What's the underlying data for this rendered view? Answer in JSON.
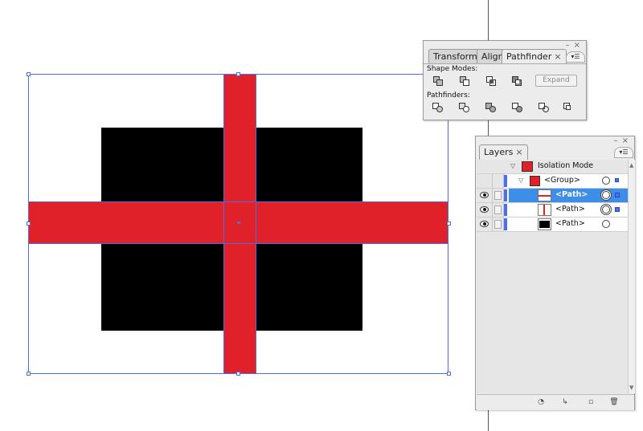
{
  "pathfinder_panel": {
    "tabs": [
      {
        "label": "Transform",
        "active": false
      },
      {
        "label": "Align",
        "active": false
      },
      {
        "label": "Pathfinder",
        "active": true,
        "close": "×"
      }
    ],
    "window_controls": "– ×",
    "menu_icon": "▾☰",
    "shape_modes_label": "Shape Modes:",
    "shape_modes": [
      "unite-icon",
      "minus-front-icon",
      "intersect-icon",
      "exclude-icon"
    ],
    "expand_label": "Expand",
    "pathfinders_label": "Pathfinders:",
    "pathfinders": [
      "divide-icon",
      "trim-icon",
      "merge-icon",
      "crop-icon",
      "outline-icon",
      "minus-back-icon"
    ]
  },
  "layers_panel": {
    "tab": {
      "label": "Layers",
      "close": "×"
    },
    "window_controls": "– ×",
    "menu_icon": "▾☰",
    "rows": [
      {
        "name": "Isolation Mode",
        "level": 0,
        "expanded": true,
        "selected": false
      },
      {
        "name": "<Group>",
        "level": 1,
        "expanded": true,
        "selected": false
      },
      {
        "name": "<Path>",
        "level": 2,
        "selected": true,
        "thumb": "red-horizontal"
      },
      {
        "name": "<Path>",
        "level": 2,
        "selected": false,
        "thumb": "red-vertical"
      },
      {
        "name": "<Path>",
        "level": 2,
        "selected": false,
        "thumb": "black"
      }
    ],
    "footer_icons": [
      "make-clipping-mask-icon",
      "create-sublayer-icon",
      "new-layer-icon",
      "trash-icon"
    ]
  },
  "colors": {
    "red": "#e0212a",
    "black": "#000000",
    "selection": "#4a6fe3",
    "layer_highlight": "#3d8ee8"
  }
}
